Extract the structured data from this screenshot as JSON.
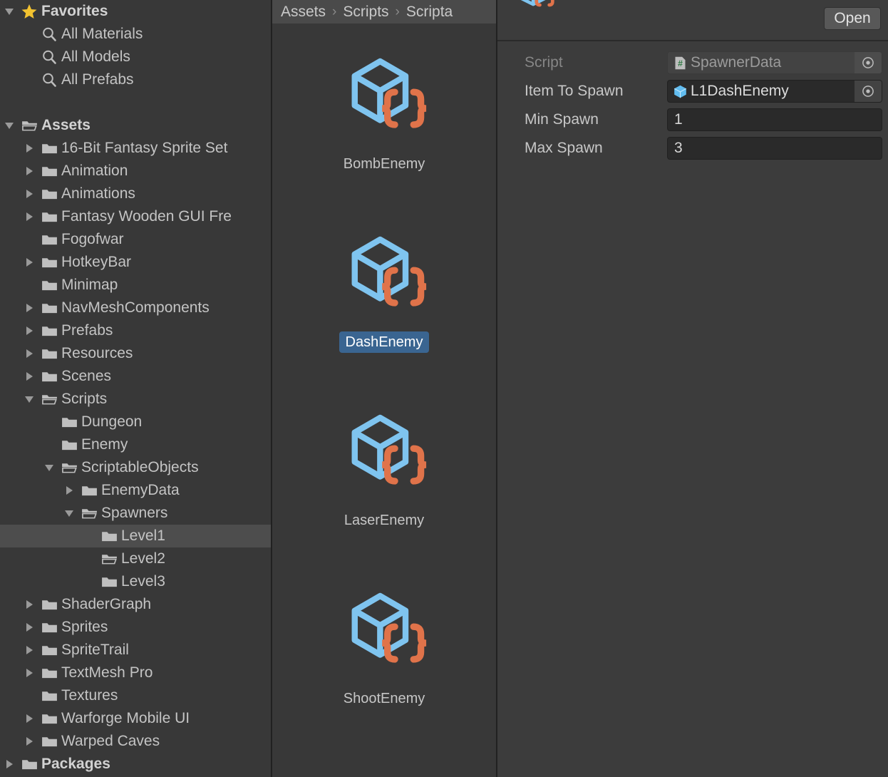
{
  "tree": {
    "items": [
      {
        "label": "Favorites",
        "depth": 0,
        "twisty": "down",
        "icon": "star-icon",
        "bold": true,
        "selected": false
      },
      {
        "label": "All Materials",
        "depth": 1,
        "twisty": "none",
        "icon": "search-icon",
        "bold": false,
        "selected": false
      },
      {
        "label": "All Models",
        "depth": 1,
        "twisty": "none",
        "icon": "search-icon",
        "bold": false,
        "selected": false
      },
      {
        "label": "All Prefabs",
        "depth": 1,
        "twisty": "none",
        "icon": "search-icon",
        "bold": false,
        "selected": false
      },
      {
        "label": "",
        "depth": 0,
        "twisty": "none",
        "icon": "none",
        "bold": false,
        "selected": false
      },
      {
        "label": "Assets",
        "depth": 0,
        "twisty": "down",
        "icon": "folder-open-icon",
        "bold": true,
        "selected": false
      },
      {
        "label": "16-Bit Fantasy Sprite Set",
        "depth": 1,
        "twisty": "right",
        "icon": "folder-icon",
        "bold": false,
        "selected": false
      },
      {
        "label": "Animation",
        "depth": 1,
        "twisty": "right",
        "icon": "folder-icon",
        "bold": false,
        "selected": false
      },
      {
        "label": "Animations",
        "depth": 1,
        "twisty": "right",
        "icon": "folder-icon",
        "bold": false,
        "selected": false
      },
      {
        "label": "Fantasy Wooden GUI  Fre",
        "depth": 1,
        "twisty": "right",
        "icon": "folder-icon",
        "bold": false,
        "selected": false
      },
      {
        "label": "Fogofwar",
        "depth": 1,
        "twisty": "none",
        "icon": "folder-icon",
        "bold": false,
        "selected": false
      },
      {
        "label": "HotkeyBar",
        "depth": 1,
        "twisty": "right",
        "icon": "folder-icon",
        "bold": false,
        "selected": false
      },
      {
        "label": "Minimap",
        "depth": 1,
        "twisty": "none",
        "icon": "folder-icon",
        "bold": false,
        "selected": false
      },
      {
        "label": "NavMeshComponents",
        "depth": 1,
        "twisty": "right",
        "icon": "folder-icon",
        "bold": false,
        "selected": false
      },
      {
        "label": "Prefabs",
        "depth": 1,
        "twisty": "right",
        "icon": "folder-icon",
        "bold": false,
        "selected": false
      },
      {
        "label": "Resources",
        "depth": 1,
        "twisty": "right",
        "icon": "folder-icon",
        "bold": false,
        "selected": false
      },
      {
        "label": "Scenes",
        "depth": 1,
        "twisty": "right",
        "icon": "folder-icon",
        "bold": false,
        "selected": false
      },
      {
        "label": "Scripts",
        "depth": 1,
        "twisty": "down",
        "icon": "folder-open-icon",
        "bold": false,
        "selected": false
      },
      {
        "label": "Dungeon",
        "depth": 2,
        "twisty": "none",
        "icon": "folder-icon",
        "bold": false,
        "selected": false
      },
      {
        "label": "Enemy",
        "depth": 2,
        "twisty": "none",
        "icon": "folder-icon",
        "bold": false,
        "selected": false
      },
      {
        "label": "ScriptableObjects",
        "depth": 2,
        "twisty": "down",
        "icon": "folder-open-icon",
        "bold": false,
        "selected": false
      },
      {
        "label": "EnemyData",
        "depth": 3,
        "twisty": "right",
        "icon": "folder-icon",
        "bold": false,
        "selected": false
      },
      {
        "label": "Spawners",
        "depth": 3,
        "twisty": "down",
        "icon": "folder-open-icon",
        "bold": false,
        "selected": false
      },
      {
        "label": "Level1",
        "depth": 4,
        "twisty": "none",
        "icon": "folder-icon",
        "bold": false,
        "selected": true
      },
      {
        "label": "Level2",
        "depth": 4,
        "twisty": "none",
        "icon": "folder-open-icon",
        "bold": false,
        "selected": false
      },
      {
        "label": "Level3",
        "depth": 4,
        "twisty": "none",
        "icon": "folder-icon",
        "bold": false,
        "selected": false
      },
      {
        "label": "ShaderGraph",
        "depth": 1,
        "twisty": "right",
        "icon": "folder-icon",
        "bold": false,
        "selected": false
      },
      {
        "label": "Sprites",
        "depth": 1,
        "twisty": "right",
        "icon": "folder-icon",
        "bold": false,
        "selected": false
      },
      {
        "label": "SpriteTrail",
        "depth": 1,
        "twisty": "right",
        "icon": "folder-icon",
        "bold": false,
        "selected": false
      },
      {
        "label": "TextMesh Pro",
        "depth": 1,
        "twisty": "right",
        "icon": "folder-icon",
        "bold": false,
        "selected": false
      },
      {
        "label": "Textures",
        "depth": 1,
        "twisty": "none",
        "icon": "folder-icon",
        "bold": false,
        "selected": false
      },
      {
        "label": "Warforge Mobile UI",
        "depth": 1,
        "twisty": "right",
        "icon": "folder-icon",
        "bold": false,
        "selected": false
      },
      {
        "label": "Warped Caves",
        "depth": 1,
        "twisty": "right",
        "icon": "folder-icon",
        "bold": false,
        "selected": false
      },
      {
        "label": "Packages",
        "depth": 0,
        "twisty": "right",
        "icon": "folder-icon",
        "bold": true,
        "selected": false
      }
    ]
  },
  "breadcrumb": {
    "crumbs": [
      "Assets",
      "Scripts",
      "Scripta"
    ],
    "separator": "›"
  },
  "grid": {
    "items": [
      {
        "label": "BombEnemy",
        "icon": "scriptable-object-icon",
        "selected": false
      },
      {
        "label": "DashEnemy",
        "icon": "scriptable-object-icon",
        "selected": true
      },
      {
        "label": "LaserEnemy",
        "icon": "scriptable-object-icon",
        "selected": false
      },
      {
        "label": "ShootEnemy",
        "icon": "scriptable-object-icon",
        "selected": false
      }
    ]
  },
  "inspector": {
    "header_icon": "scriptable-object-icon",
    "open_label": "Open",
    "fields": [
      {
        "label": "Script",
        "type": "object",
        "value": "SpawnerData",
        "icon": "cs-script-icon",
        "disabled": true,
        "picker": true
      },
      {
        "label": "Item To Spawn",
        "type": "object",
        "value": "L1DashEnemy",
        "icon": "prefab-cube-icon",
        "disabled": false,
        "picker": true
      },
      {
        "label": "Min Spawn",
        "type": "number",
        "value": "1",
        "icon": "none",
        "disabled": false,
        "picker": false
      },
      {
        "label": "Max Spawn",
        "type": "number",
        "value": "3",
        "icon": "none",
        "disabled": false,
        "picker": false
      }
    ]
  },
  "colors": {
    "panel_bg": "#383838",
    "inspector_bg": "#3c3c3c",
    "breadcrumb_bg": "#4a4a4a",
    "selection_blue": "#3a6591",
    "row_selected": "#4d4d4d",
    "icon_cube_blue": "#7fc4ef",
    "icon_brace_orange": "#e0734a",
    "star_yellow": "#f2c230",
    "folder_grey": "#c0c0c0"
  }
}
